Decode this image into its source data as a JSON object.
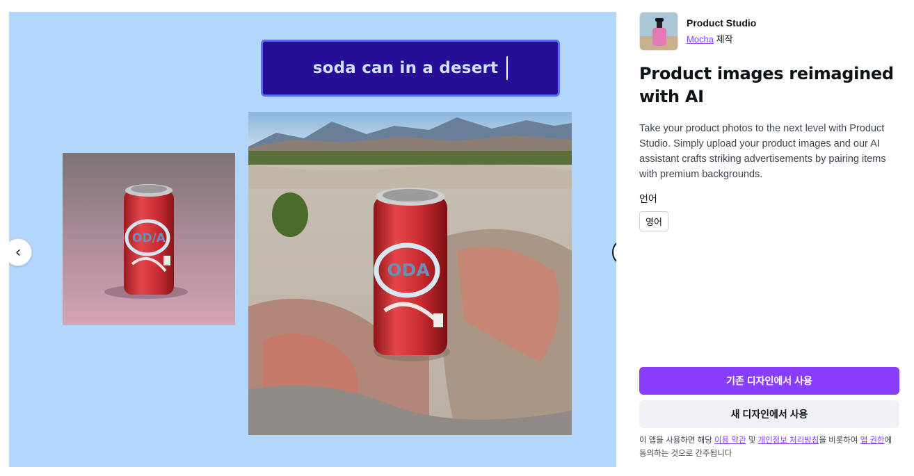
{
  "preview": {
    "prompt_text": "soda can in a desert",
    "prev_arrow": "‹",
    "next_arrow": "›",
    "colors": {
      "background": "#b3d6fd",
      "prompt_bg": "#260e96",
      "prompt_border": "#5a6cf5"
    }
  },
  "app": {
    "name": "Product Studio",
    "author": "Mocha",
    "author_suffix": " 제작",
    "headline": "Product images reimagined with AI",
    "description": "Take your product photos to the next level with Product Studio. Simply upload your product images and our AI assistant crafts striking advertisements by pairing items with premium backgrounds.",
    "language_label": "언어",
    "language_value": "영어"
  },
  "actions": {
    "use_existing": "기존 디자인에서 사용",
    "use_new": "새 디자인에서 사용"
  },
  "terms": {
    "prefix": "이 앱을 사용하면 해당 ",
    "terms_link": "이용 약관",
    "and": " 및 ",
    "privacy_link": "개인정보 처리방침",
    "middle": "을 비롯하여 ",
    "permissions_link": "앱 권한",
    "suffix": "에 동의하는 것으로 간주됩니다"
  },
  "colors": {
    "accent": "#8b3dff",
    "secondary_button": "#f0f1f4"
  }
}
